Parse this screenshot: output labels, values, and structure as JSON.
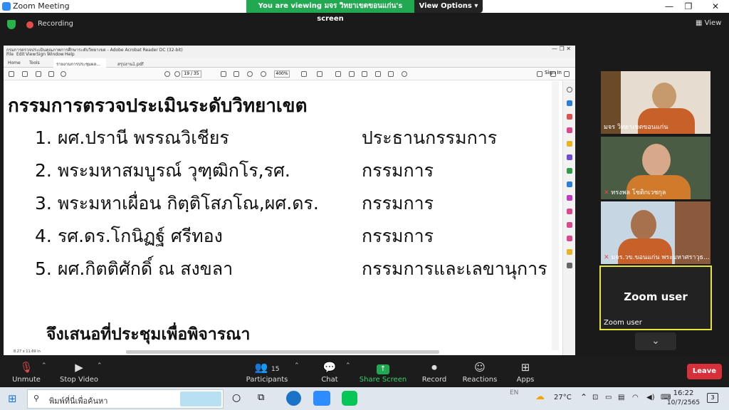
{
  "window": {
    "title": "Zoom Meeting",
    "minimize": "—",
    "restore": "❐",
    "close": "✕"
  },
  "banner": {
    "viewing_text": "You are viewing มจร วิทยาเขตขอนแก่น's screen",
    "view_options": "View Options"
  },
  "meeting": {
    "recording": "Recording",
    "view": "View"
  },
  "acrobat": {
    "window_title": "กรมการตรวจประเมินคุณภาพการศึกษาระดับวิทยาเขต - Adobe Acrobat Reader DC (32-bit)",
    "menu": [
      "File",
      "Edit",
      "View",
      "Sign",
      "Window",
      "Help"
    ],
    "tabs": [
      "Home",
      "Tools",
      "รายงานการประชุมผล...",
      "สรุปงาน1.pdf"
    ],
    "page_current": "19",
    "page_total": "/ 35",
    "zoom": "400%",
    "sign_in": "Sign In",
    "page_size": "8.27 x 11.69 in"
  },
  "document": {
    "heading": "กรรมการตรวจประเมินระดับวิทยาเขต",
    "members": [
      {
        "num": "1.",
        "name": "ผศ.ปรานี พรรณวิเชียร",
        "role": "ประธานกรรมการ"
      },
      {
        "num": "2.",
        "name": "พระมหาสมบูรณ์ วุฑฺฒิกโร,รศ.",
        "role": "กรรมการ"
      },
      {
        "num": "3.",
        "name": "พระมหาเผื่อน กิตฺติโสภโณ,ผศ.ดร.",
        "role": "กรรมการ"
      },
      {
        "num": "4.",
        "name": "รศ.ดร.โกนิฏฐ์ ศรีทอง",
        "role": "กรรมการ"
      },
      {
        "num": "5.",
        "name": "ผศ.กิตติศักดิ์ ณ สงขลา",
        "role": "กรรมการและเลขานุการ"
      }
    ],
    "footer": "จึงเสนอที่ประชุมเพื่อพิจารณา"
  },
  "participants_video": [
    {
      "name": "มจร วิทยาเขตขอนแก่น"
    },
    {
      "name": "ทรงพล โชติกเวชกุล"
    },
    {
      "name": "มจร.วข.ขอนแก่น พระมหาศราวุธ..."
    }
  ],
  "zoom_user": {
    "big": "Zoom user",
    "small": "Zoom user"
  },
  "toolbar": {
    "unmute": "Unmute",
    "stop_video": "Stop Video",
    "participants": "Participants",
    "participants_count": "15",
    "chat": "Chat",
    "share_screen": "Share Screen",
    "record": "Record",
    "reactions": "Reactions",
    "apps": "Apps",
    "leave": "Leave"
  },
  "taskbar": {
    "search_placeholder": "พิมพ์ที่นี่เพื่อค้นหา",
    "lang": "EN",
    "temperature": "27°C",
    "time": "16:22",
    "date": "10/7/2565",
    "notifications": "3"
  },
  "colors": {
    "zoom_blue": "#2d8cff",
    "banner_green": "#23a852",
    "leave_red": "#d6303a",
    "active_speaker": "#e7e43a"
  }
}
